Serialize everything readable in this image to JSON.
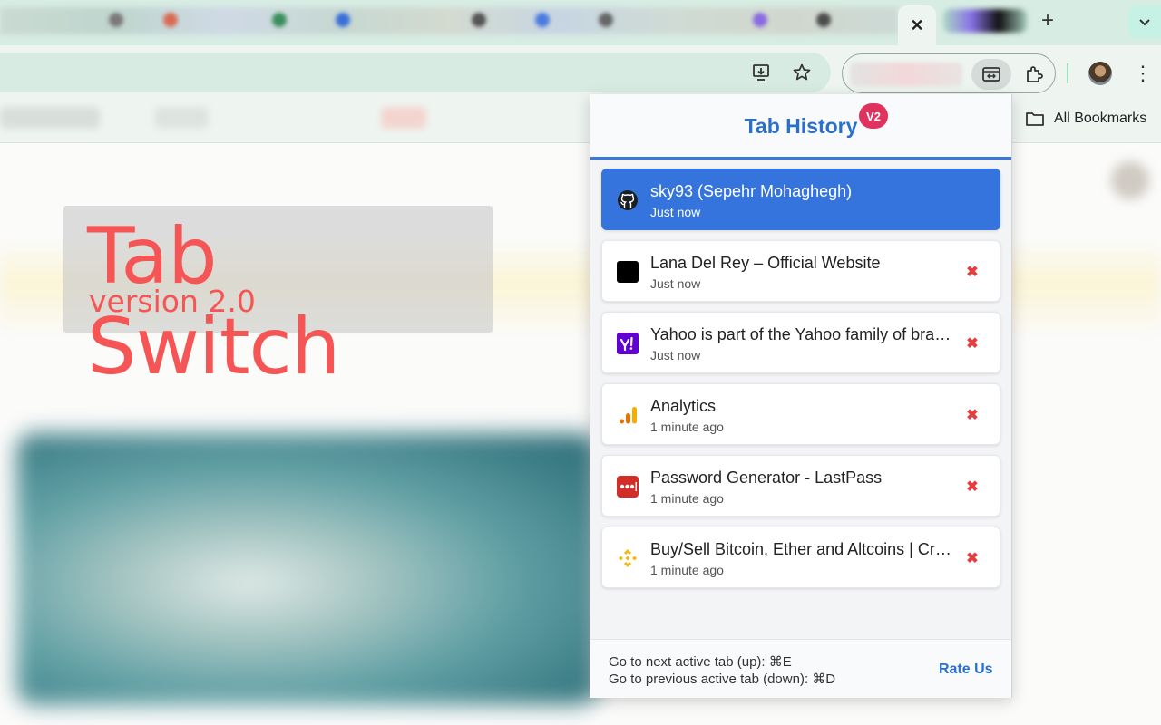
{
  "browser": {
    "tab_close_glyph": "✕",
    "new_tab_glyph": "+",
    "tab_search_glyph": "⌄",
    "menu_glyph": "⋮",
    "bookmarks_label": "All Bookmarks"
  },
  "page": {
    "title": "Tab Switch",
    "subtitle": "version 2.0"
  },
  "popup": {
    "title": "Tab History",
    "badge": "V2",
    "items": [
      {
        "title": "sky93 (Sepehr Mohaghegh)",
        "time": "Just now",
        "icon": "github-icon",
        "active": true
      },
      {
        "title": "Lana Del Rey – Official Website",
        "time": "Just now",
        "icon": "black-square-icon",
        "active": false
      },
      {
        "title": "Yahoo is part of the Yahoo family of brands",
        "time": "Just now",
        "icon": "yahoo-icon",
        "active": false
      },
      {
        "title": "Analytics",
        "time": "1 minute ago",
        "icon": "analytics-icon",
        "active": false
      },
      {
        "title": "Password Generator - LastPass",
        "time": "1 minute ago",
        "icon": "lastpass-icon",
        "active": false
      },
      {
        "title": "Buy/Sell Bitcoin, Ether and Altcoins | Cryptocurrency Exchange",
        "time": "1 minute ago",
        "icon": "binance-icon",
        "active": false
      }
    ],
    "remove_glyph": "✖",
    "footer": {
      "shortcut_next": "Go to next active tab (up): ⌘E",
      "shortcut_prev": "Go to previous active tab (down): ⌘D",
      "rate_us": "Rate Us"
    }
  },
  "colors": {
    "accent": "#3574dc",
    "title_red": "#f55555",
    "badge": "#e0325e",
    "remove": "#e53e3e"
  }
}
